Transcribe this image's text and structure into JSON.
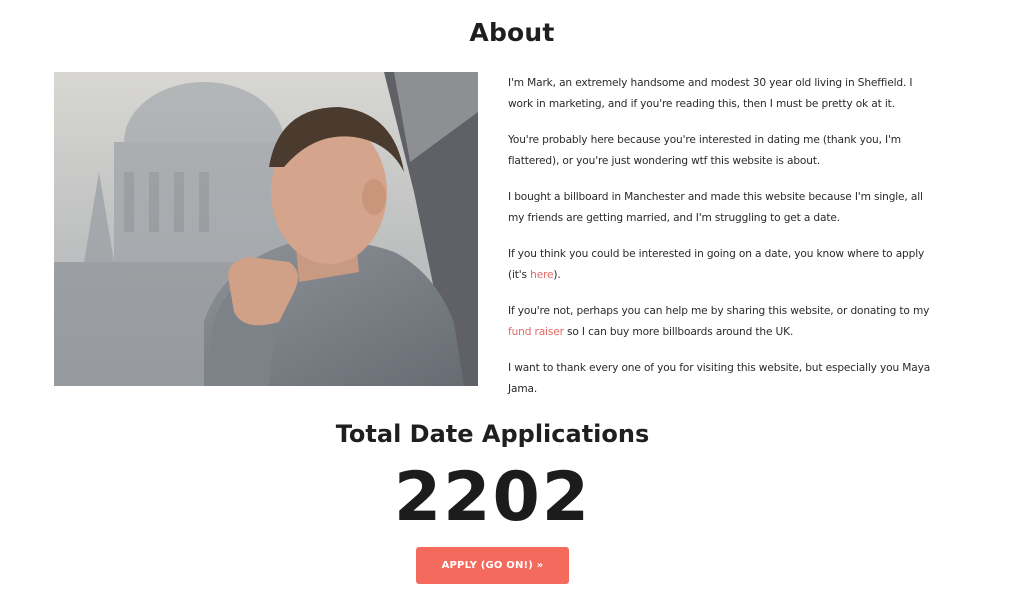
{
  "about": {
    "title": "About",
    "paragraphs": {
      "p1": "I'm Mark, an extremely handsome and modest 30 year old living in Sheffield. I work in marketing, and if you're reading this, then I must be pretty ok at it.",
      "p2": "You're probably here because you're interested in dating me (thank you, I'm flattered), or you're just wondering wtf this website is about.",
      "p3": "I bought a billboard in Manchester and made this website because I'm single, all my friends are getting married, and I'm struggling to get a date.",
      "p4_before": "If you think you could be interested in going on a date, you know where to apply (it's ",
      "p4_link": "here",
      "p4_after": ").",
      "p5_before": "If you're not, perhaps you can help me by sharing this website, or donating to my ",
      "p5_link": "fund raiser",
      "p5_after": " so I can buy more billboards around the UK.",
      "p6": "I want to thank every one of you for visiting this website, but especially you Maya Jama."
    },
    "link_color": "#e06a64"
  },
  "applications": {
    "title": "Total Date Applications",
    "count": "2202",
    "button_label": "APPLY (GO ON!) »"
  },
  "colors": {
    "button": "#f46b5d",
    "heading": "#1f1f1f"
  }
}
